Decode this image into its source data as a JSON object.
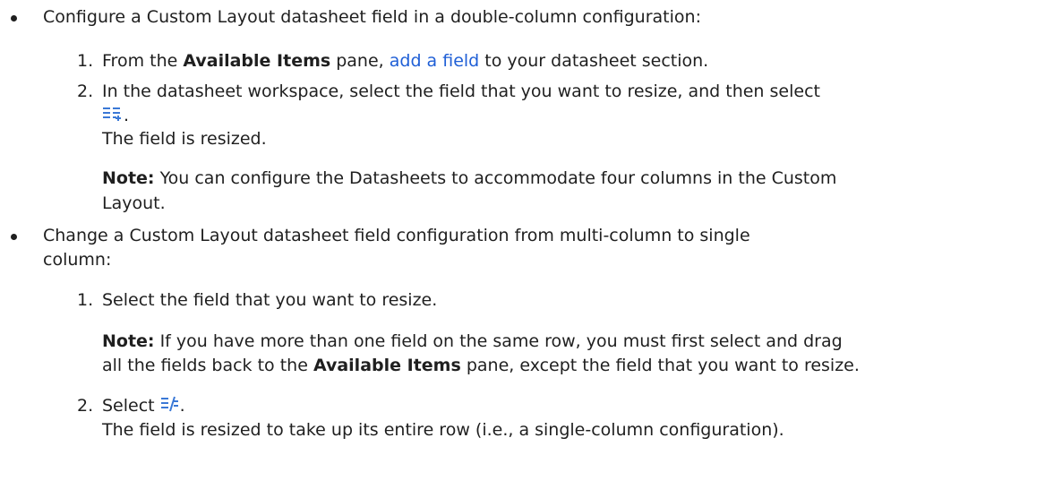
{
  "b1": {
    "intro": "Configure a Custom Layout datasheet field in a double-column configuration:",
    "s1_num": "1.",
    "s1_pre": "From the ",
    "s1_bold": "Available Items",
    "s1_mid": " pane, ",
    "s1_link": "add a field",
    "s1_post": " to your datasheet section.",
    "s2_num": "2.",
    "s2_text": "In the datasheet workspace, select the field that you want to resize, and then select",
    "s2_icon_name": "resize-multi-column-icon",
    "s2_period": ".",
    "s2_result": "The field is resized.",
    "note_label": "Note:",
    "note_line1": " You can configure the Datasheets to accommodate four columns in the Custom",
    "note_line2": "Layout."
  },
  "b2": {
    "intro_line1": "Change a Custom Layout datasheet field configuration from multi-column to single",
    "intro_line2": "column:",
    "s1_num": "1.",
    "s1_text": "Select the field that you want to resize.",
    "note_label": "Note:",
    "note_line1": " If you have more than one field on the same row, you must first select and drag",
    "note_line2_pre": "all the fields back to the ",
    "note_line2_bold": "Available Items",
    "note_line2_post": " pane, except the field that you want to resize.",
    "s2_num": "2.",
    "s2_pre": "Select ",
    "s2_icon_name": "resize-single-column-icon",
    "s2_period": ".",
    "s2_result": "The field is resized to take up its entire row (i.e., a single-column configuration)."
  },
  "colors": {
    "text": "#1f1f1f",
    "link": "#1f5fd6",
    "icon": "#3a78d6"
  }
}
